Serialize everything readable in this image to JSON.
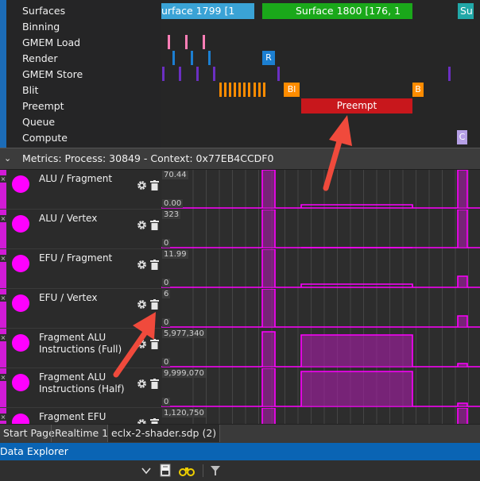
{
  "timeline": {
    "lanes": [
      "Surfaces",
      "Binning",
      "GMEM Load",
      "Render",
      "GMEM Store",
      "Blit",
      "Preempt",
      "Queue",
      "Compute"
    ],
    "surfaces": [
      {
        "label": "urface 1799 [1",
        "color": "#3aa3d6"
      },
      {
        "label": "Surface 1800 [176, 1",
        "color": "#1aa81a"
      },
      {
        "label": "Su",
        "color": "#21a8a8"
      }
    ],
    "render_block_label": "R",
    "blit_labels": [
      "Bl",
      "B"
    ],
    "preempt_label": "Preempt",
    "compute_label": "C"
  },
  "metrics": {
    "title": "Metrics: Process: 30849 - Context: 0x77EB4CCDF0",
    "rows": [
      {
        "name": "ALU / Fragment",
        "max": "70.44",
        "min": "0.00"
      },
      {
        "name": "ALU / Vertex",
        "max": "323",
        "min": "0"
      },
      {
        "name": "EFU / Fragment",
        "max": "11.99",
        "min": "0"
      },
      {
        "name": "EFU / Vertex",
        "max": "6",
        "min": "0"
      },
      {
        "name": "Fragment ALU Instructions (Full)",
        "max": "5,977,340",
        "min": "0"
      },
      {
        "name": "Fragment ALU Instructions (Half)",
        "max": "9,999,070",
        "min": "0"
      },
      {
        "name": "Fragment EFU",
        "max": "1,120,750",
        "min": ""
      }
    ]
  },
  "tabs": [
    "Start Page",
    "Realtime 1",
    "eclx-2-shader.sdp (2)"
  ],
  "data_explorer": {
    "title": "Data Explorer"
  },
  "colors": {
    "accent": "#ff00ff",
    "preempt": "#c8171c",
    "blit": "#ff8c00",
    "render": "#1c7fd1",
    "store": "#6b2fc2",
    "load": "#ff7eb6",
    "arrow": "#f04a3c"
  },
  "icons": [
    "gear-icon",
    "trash-icon",
    "chevron-down-icon",
    "export-icon",
    "binoculars-icon",
    "filter-icon"
  ]
}
